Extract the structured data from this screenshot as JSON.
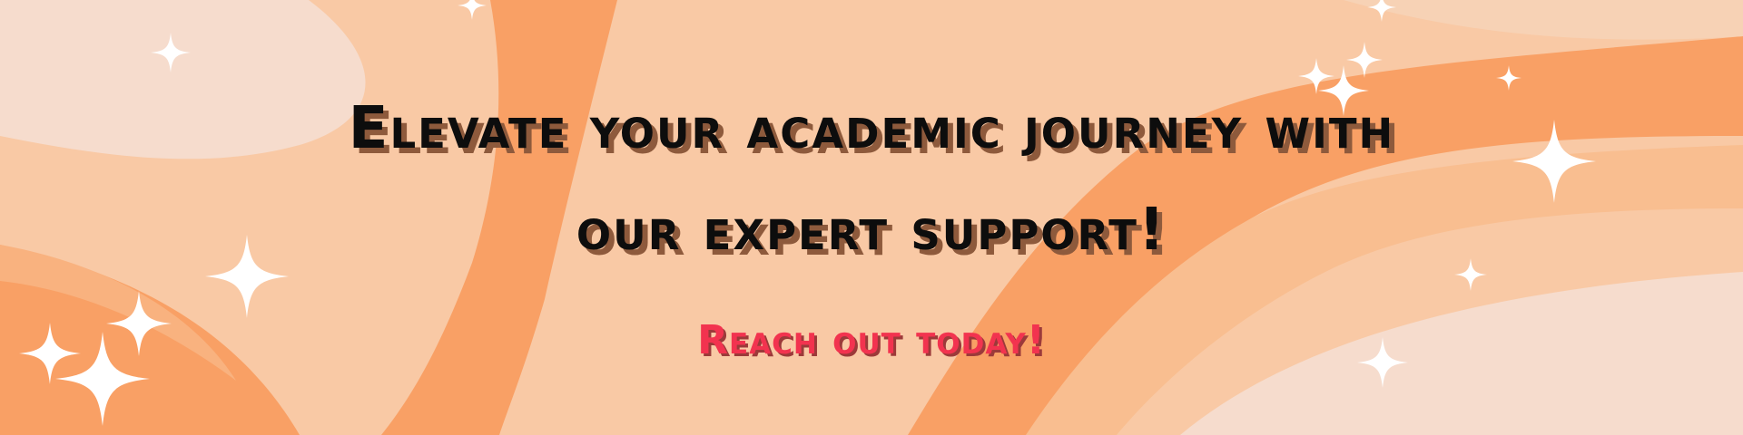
{
  "banner": {
    "headline_line1": "Elevate your academic journey with",
    "headline_line2": "our expert support!",
    "cta": "Reach out today!"
  },
  "colors": {
    "background": "#f9c9a5",
    "wave_dark": "#f9a065",
    "wave_light": "#f6dccd",
    "headline": "#0d0d0d",
    "headline_shadow": "#8e5a3c",
    "cta": "#f2334f",
    "sparkle": "#ffffff"
  },
  "icons": [
    "sparkle-icon"
  ]
}
